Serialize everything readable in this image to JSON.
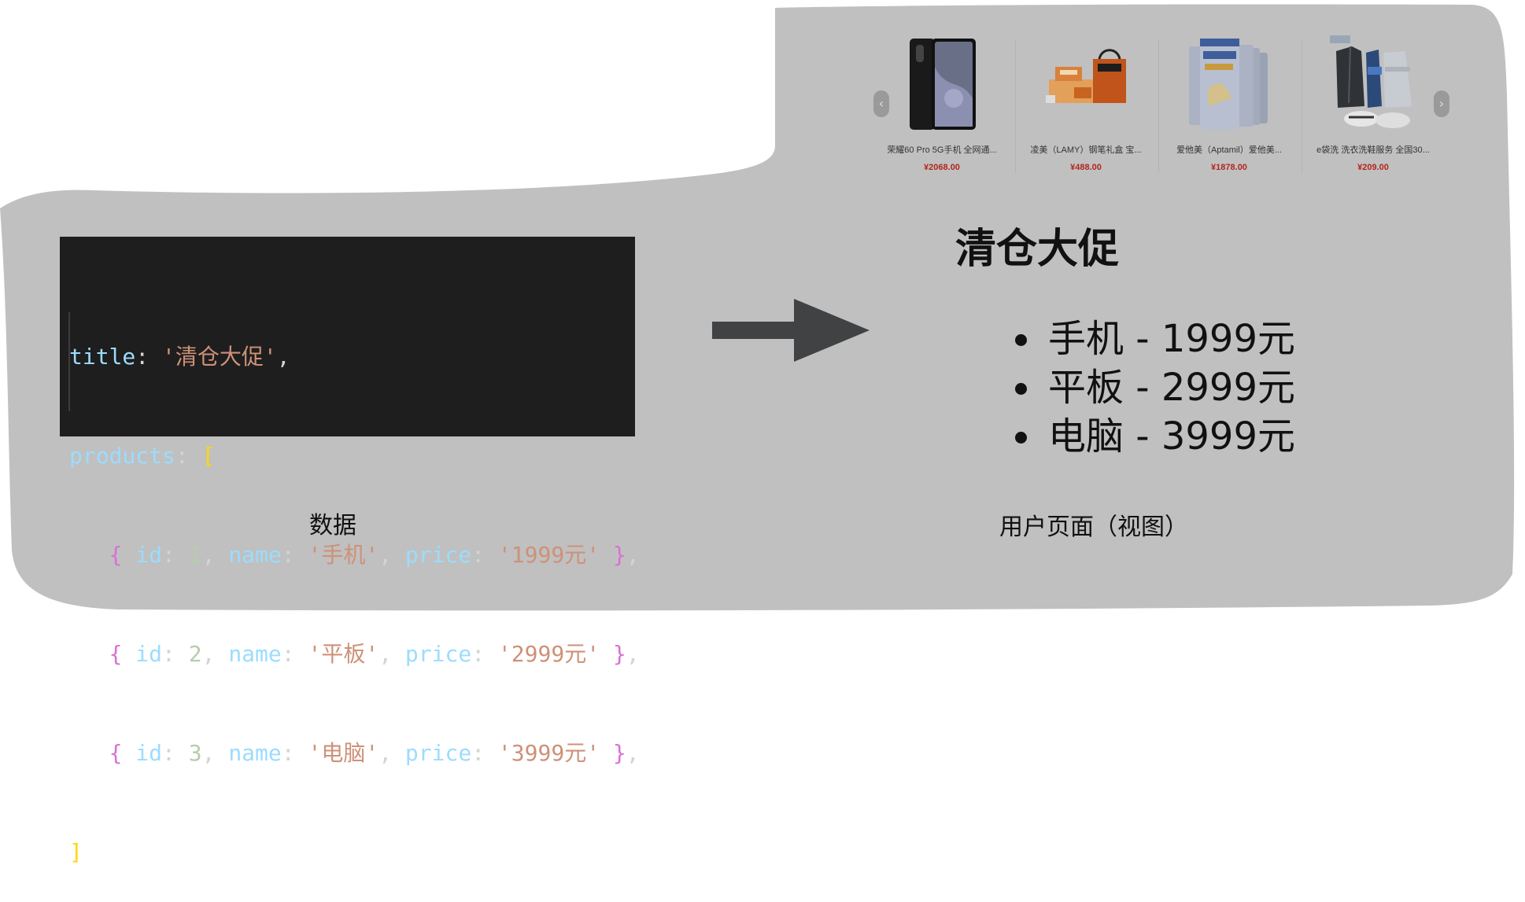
{
  "code": {
    "title_key": "title",
    "title_value": "'清仓大促'",
    "products_key": "products",
    "items": [
      {
        "id": "1",
        "name": "'手机'",
        "price": "'1999元'"
      },
      {
        "id": "2",
        "name": "'平板'",
        "price": "'2999元'"
      },
      {
        "id": "3",
        "name": "'电脑'",
        "price": "'3999元'"
      }
    ]
  },
  "view": {
    "title": "清仓大促",
    "items": [
      "手机 - 1999元",
      "平板 - 2999元",
      "电脑 - 3999元"
    ]
  },
  "products_strip": [
    {
      "name": "荣耀60 Pro 5G手机 全网通...",
      "price": "¥2068.00"
    },
    {
      "name": "凌美（LAMY）钢笔礼盒 宝...",
      "price": "¥488.00"
    },
    {
      "name": "爱他美（Aptamil）爱他美...",
      "price": "¥1878.00"
    },
    {
      "name": "e袋洗 洗衣洗鞋服务 全国30...",
      "price": "¥209.00"
    }
  ],
  "captions": {
    "left": "数据",
    "right": "用户页面（视图）"
  },
  "colors": {
    "background_shape": "#c0c0c0",
    "code_bg": "#1e1e1e",
    "arrow": "#404244",
    "price_red": "#b3261e"
  }
}
